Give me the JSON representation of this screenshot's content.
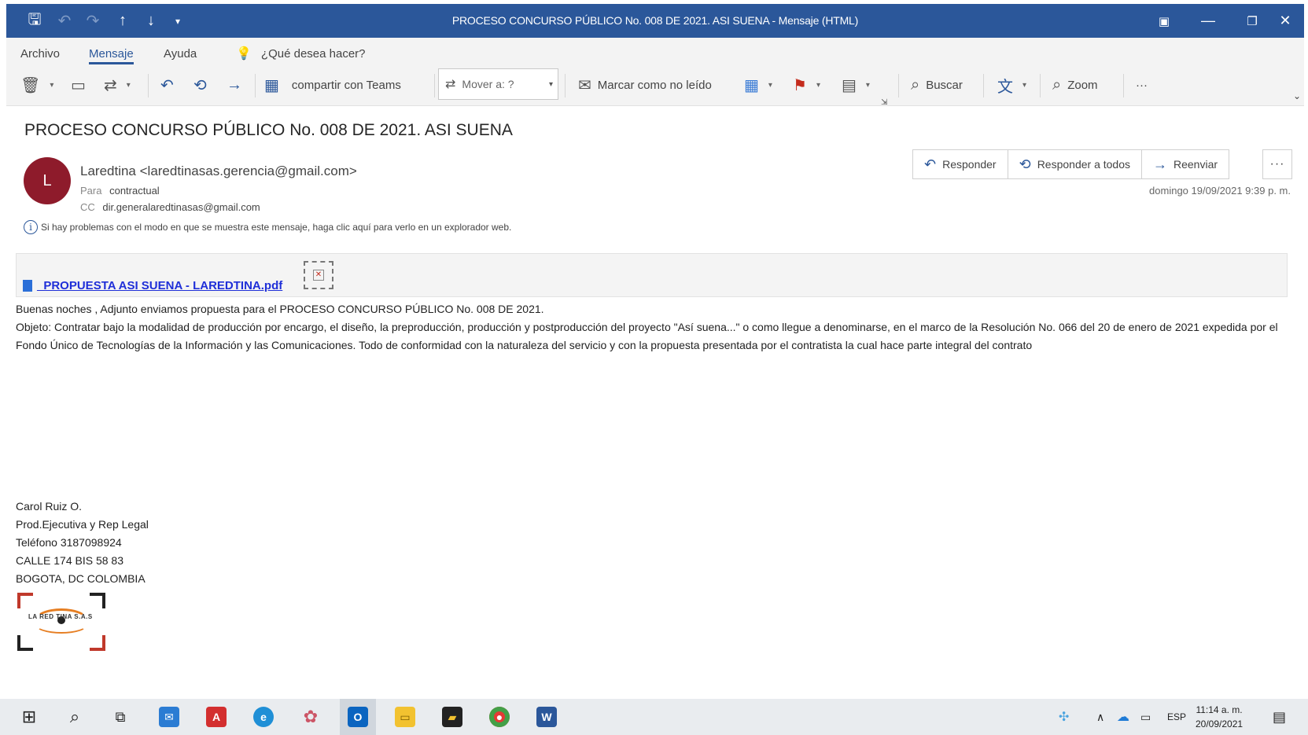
{
  "window": {
    "title": "PROCESO CONCURSO PÚBLICO No. 008 DE 2021. ASI SUENA  -  Mensaje (HTML)"
  },
  "ribbon": {
    "menu": [
      "Archivo",
      "Mensaje",
      "Ayuda"
    ],
    "search_prompt": "¿Qué desea hacer?",
    "share_teams": "compartir con Teams",
    "move_to": "Mover a: ?",
    "mark_unread": "Marcar como no leído",
    "find": "Buscar",
    "zoom": "Zoom",
    "more": "···"
  },
  "message": {
    "subject": "PROCESO CONCURSO PÚBLICO No. 008 DE 2021. ASI SUENA",
    "avatar_initial": "L",
    "sender": "Laredtina <laredtinasas.gerencia@gmail.com>",
    "to_label": "Para",
    "to": "contractual",
    "cc_label": "CC",
    "cc": "dir.generalaredtinasas@gmail.com",
    "info": "Si hay problemas con el modo en que se muestra este mensaje, haga clic aquí para verlo en un explorador web.",
    "date": "domingo 19/09/2021 9:39 p. m.",
    "actions": [
      "Responder",
      "Responder a todos",
      "Reenviar"
    ],
    "more": "···"
  },
  "attachment": {
    "filename": "_PROPUESTA ASI SUENA - LAREDTINA.pdf"
  },
  "body": {
    "line1": "Buenas noches , Adjunto enviamos propuesta para el PROCESO CONCURSO PÚBLICO No. 008 DE 2021.",
    "line2": "Objeto: Contratar bajo la modalidad de producción por encargo, el diseño, la preproducción, producción y postproducción del proyecto \"Así suena...\" o como llegue a denominarse, en el marco de la Resolución No. 066 del 20 de enero de 2021 expedida por el Fondo Único de Tecnologías de la Información y las Comunicaciones. Todo de conformidad con la naturaleza del servicio y con la propuesta presentada por el contratista la cual hace parte integral del contrato"
  },
  "signature": {
    "lines": [
      "Carol Ruiz O.",
      "Prod.Ejecutiva y Rep Legal",
      "Teléfono 3187098924",
      "CALLE 174 BIS 58 83",
      "BOGOTA, DC COLOMBIA"
    ],
    "logo_text": "LA RED  TINA S.A.S"
  },
  "taskbar": {
    "language": "ESP",
    "time": "11:14 a. m.",
    "date": "20/09/2021"
  }
}
